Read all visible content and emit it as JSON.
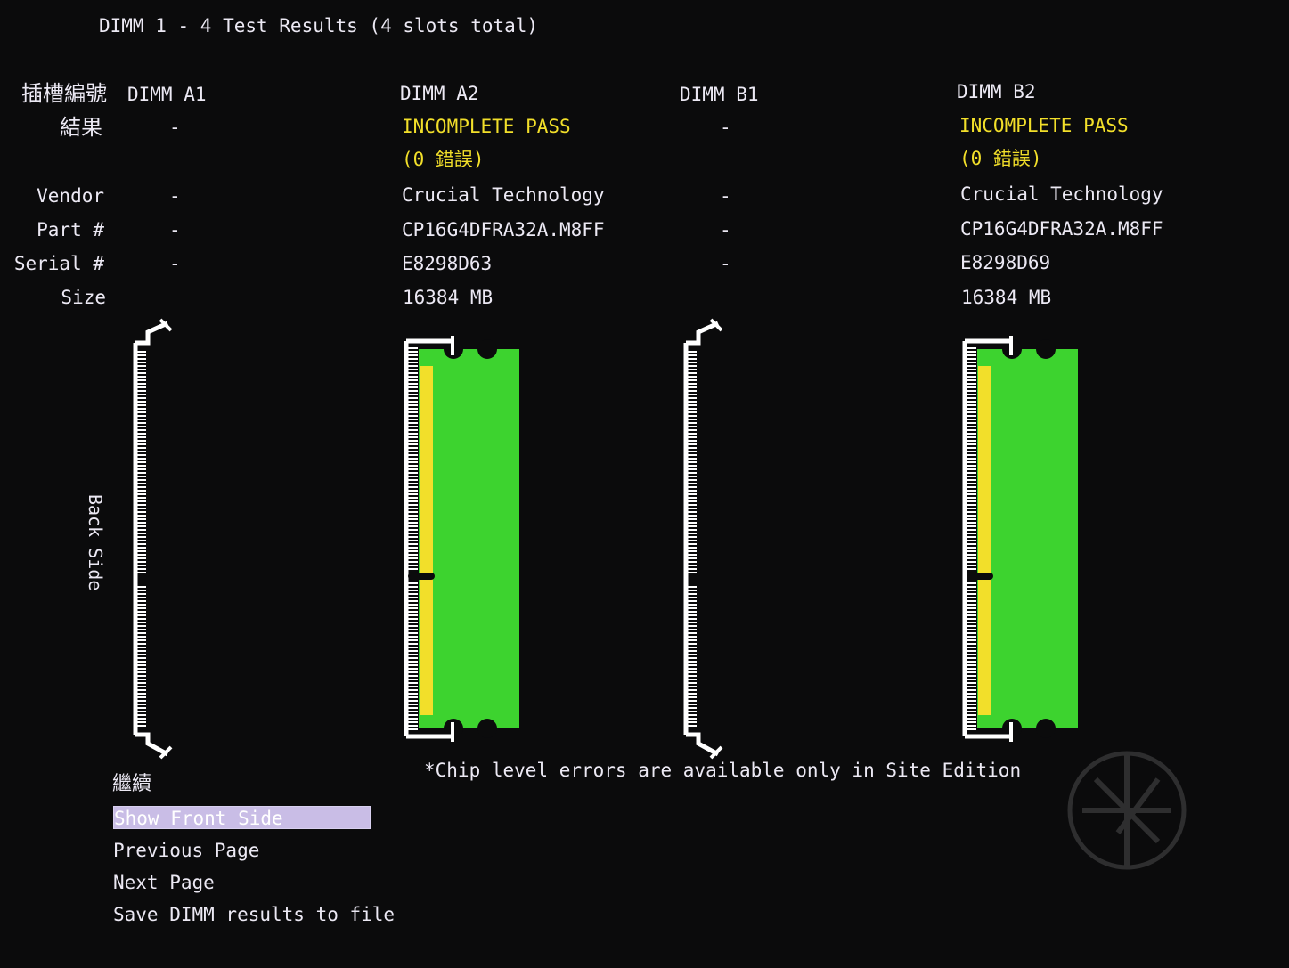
{
  "title": "DIMM 1 - 4 Test Results (4 slots total)",
  "labels": {
    "slot_number": "插槽編號",
    "result": "結果",
    "vendor": "Vendor",
    "part": "Part #",
    "serial": "Serial #",
    "size": "Size",
    "back_side": "Back Side"
  },
  "slots": [
    {
      "name": "DIMM A1",
      "installed": false,
      "result_line1": "-",
      "result_line2": "",
      "vendor": "-",
      "part": "-",
      "serial": "-",
      "size": ""
    },
    {
      "name": "DIMM A2",
      "installed": true,
      "result_line1": "INCOMPLETE PASS",
      "result_line2": "(0 錯誤)",
      "vendor": "Crucial Technology",
      "part": "CP16G4DFRA32A.M8FF",
      "serial": "E8298D63",
      "size": "16384 MB"
    },
    {
      "name": "DIMM B1",
      "installed": false,
      "result_line1": "-",
      "result_line2": "",
      "vendor": "-",
      "part": "-",
      "serial": "-",
      "size": ""
    },
    {
      "name": "DIMM B2",
      "installed": true,
      "result_line1": "INCOMPLETE PASS",
      "result_line2": "(0 錯誤)",
      "vendor": "Crucial Technology",
      "part": "CP16G4DFRA32A.M8FF",
      "serial": "E8298D69",
      "size": "16384 MB"
    }
  ],
  "menu": {
    "heading": "繼續",
    "items": [
      {
        "label": "Show Front Side",
        "selected": true
      },
      {
        "label": "Previous Page",
        "selected": false
      },
      {
        "label": "Next Page",
        "selected": false
      },
      {
        "label": "Save DIMM results to file",
        "selected": false
      }
    ]
  },
  "note": "*Chip level errors are available only in Site Edition",
  "colors": {
    "background": "#0b0b0c",
    "text": "#ece9f4",
    "pass_yellow": "#f2df2a",
    "module_green": "#3dd32f",
    "contact_yellow": "#f2df2a",
    "highlight": "#c9bde6"
  }
}
